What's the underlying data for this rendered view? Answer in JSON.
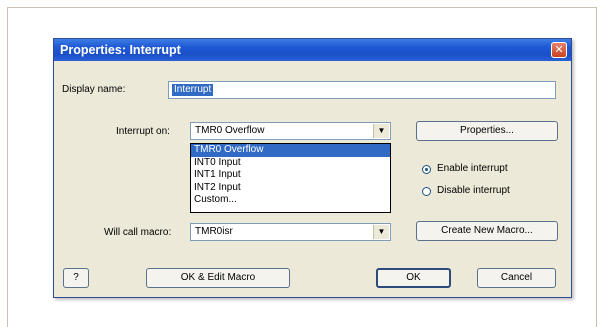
{
  "dialog": {
    "title": "Properties: Interrupt",
    "close_glyph": "✕",
    "display_name_label": "Display name:",
    "display_name_value": "Interrupt",
    "interrupt_on_label": "Interrupt on:",
    "interrupt_on_value": "TMR0 Overflow",
    "interrupt_options": [
      "TMR0 Overflow",
      "INT0 Input",
      "INT1 Input",
      "INT2 Input",
      "Custom..."
    ],
    "selected_option_index": 0,
    "properties_button": "Properties...",
    "enable_interrupt_label": "Enable interrupt",
    "disable_interrupt_label": "Disable interrupt",
    "enable_checked": true,
    "will_call_macro_label": "Will call macro:",
    "will_call_macro_value": "TMR0isr",
    "create_macro_button": "Create New Macro...",
    "help_button": "?",
    "ok_edit_button": "OK & Edit Macro",
    "ok_button": "OK",
    "cancel_button": "Cancel",
    "dropdown_arrow": "▼"
  },
  "colors": {
    "title_bar": "#1f5ad6",
    "dialog_bg": "#ece9d8",
    "selection": "#316ac5",
    "close_button": "#c8431e"
  }
}
